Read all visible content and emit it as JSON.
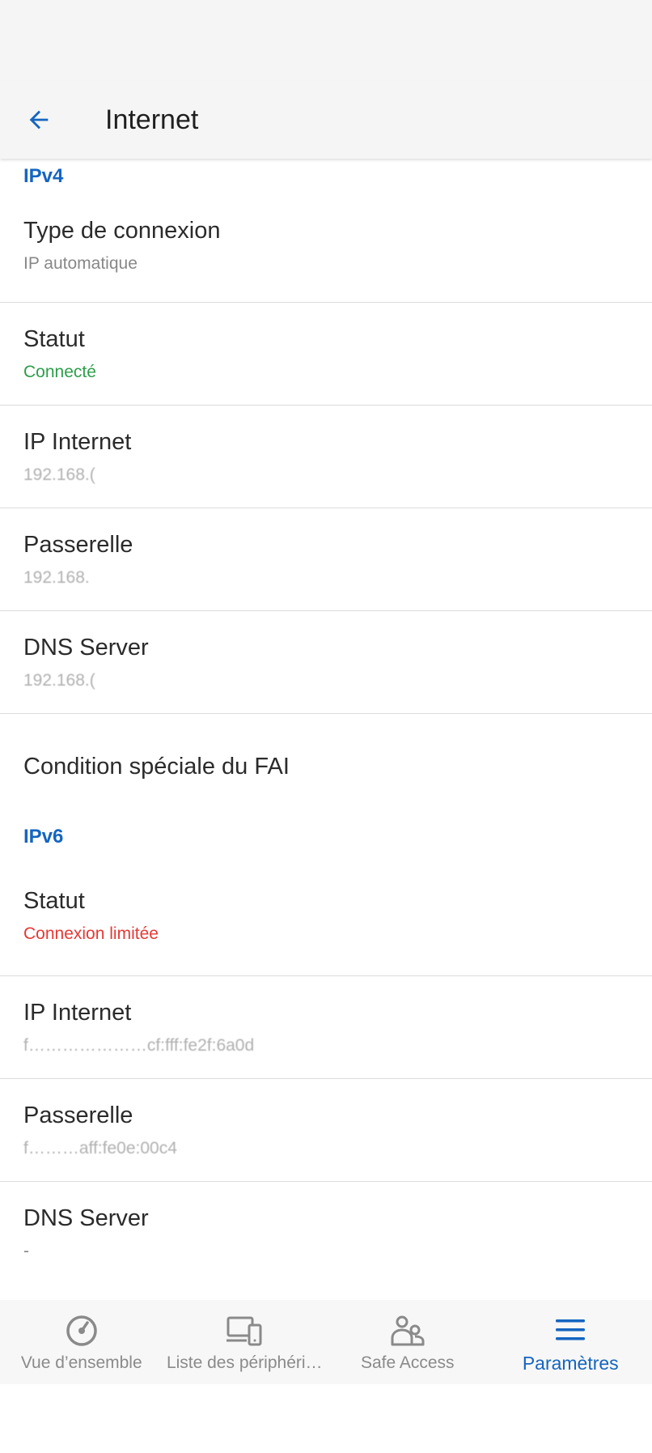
{
  "app_bar": {
    "title": "Internet",
    "back_icon": "arrow-left-icon"
  },
  "colors": {
    "accent": "#1565c0",
    "connected": "#2e9e4a",
    "limited": "#e53935"
  },
  "ipv4": {
    "header": "IPv4",
    "connection_type": {
      "label": "Type de connexion",
      "value": "IP automatique"
    },
    "status": {
      "label": "Statut",
      "value": "Connecté"
    },
    "internet_ip": {
      "label": "IP Internet",
      "value": "192.168.("
    },
    "gateway": {
      "label": "Passerelle",
      "value": "192.168."
    },
    "dns": {
      "label": "DNS Server",
      "value": "192.168.("
    },
    "isp_condition": {
      "label": "Condition spéciale du FAI"
    }
  },
  "ipv6": {
    "header": "IPv6",
    "status": {
      "label": "Statut",
      "value": "Connexion limitée"
    },
    "internet_ip": {
      "label": "IP Internet",
      "value": "f…………………cf:fff:fe2f:6a0d"
    },
    "gateway": {
      "label": "Passerelle",
      "value": "f………aff:fe0e:00c4"
    },
    "dns": {
      "label": "DNS Server",
      "value": "-"
    }
  },
  "bottom_nav": {
    "items": [
      {
        "label": "Vue d’ensemble",
        "icon": "gauge-icon"
      },
      {
        "label": "Liste des périphéri…",
        "icon": "devices-icon"
      },
      {
        "label": "Safe Access",
        "icon": "users-icon"
      },
      {
        "label": "Paramètres",
        "icon": "menu-icon",
        "active": true
      }
    ]
  }
}
